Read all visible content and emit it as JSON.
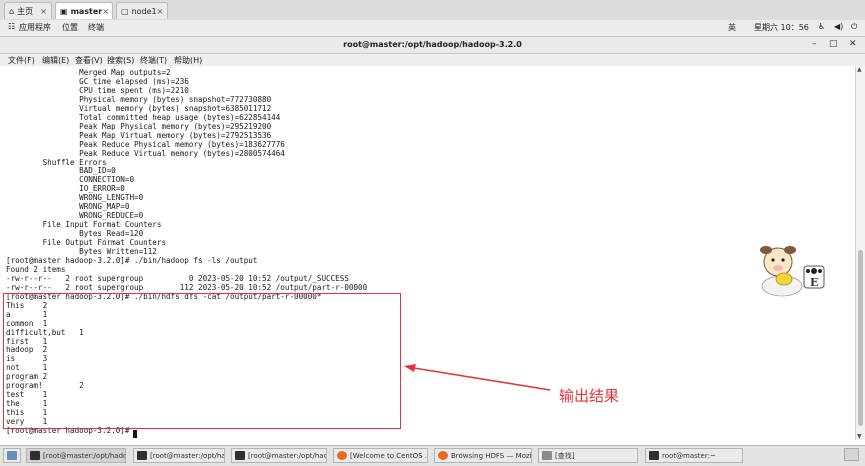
{
  "tabs": [
    {
      "label": "主页",
      "icon": "home-icon"
    },
    {
      "label": "master",
      "icon": "computer-icon"
    },
    {
      "label": "node1",
      "icon": "page-icon"
    }
  ],
  "topbar": {
    "menu_apps": "应用程序",
    "menu_places": "位置",
    "menu_terminal": "终端",
    "lang": "英",
    "clock": "星期六 10：56",
    "icons": [
      "accessibility-icon",
      "volume-icon",
      "power-icon"
    ]
  },
  "window": {
    "title": "root@master:/opt/hadoop/hadoop-3.2.0",
    "buttons": [
      "minimize-icon",
      "maximize-icon",
      "close-icon"
    ]
  },
  "menubar": [
    "文件(F)",
    "编辑(E)",
    "查看(V)",
    "搜索(S)",
    "终端(T)",
    "帮助(H)"
  ],
  "terminal_lines": [
    "                Merged Map outputs=2",
    "                GC time elapsed (ms)=236",
    "                CPU time spent (ms)=2210",
    "                Physical memory (bytes) snapshot=772730880",
    "                Virtual memory (bytes) snapshot=6385011712",
    "                Total committed heap usage (bytes)=622854144",
    "                Peak Map Physical memory (bytes)=295219200",
    "                Peak Map Virtual memory (bytes)=2792513536",
    "                Peak Reduce Physical memory (bytes)=183627776",
    "                Peak Reduce Virtual memory (bytes)=2800574464",
    "        Shuffle Errors",
    "                BAD_ID=0",
    "                CONNECTION=0",
    "                IO_ERROR=0",
    "                WRONG_LENGTH=0",
    "                WRONG_MAP=0",
    "                WRONG_REDUCE=0",
    "        File Input Format Counters",
    "                Bytes Read=120",
    "        File Output Format Counters",
    "                Bytes Written=112",
    "[root@master hadoop-3.2.0]# ./bin/hadoop fs -ls /output",
    "Found 2 items",
    "-rw-r--r--   2 root supergroup          0 2023-05-20 10:52 /output/_SUCCESS",
    "-rw-r--r--   2 root supergroup        112 2023-05-20 10:52 /output/part-r-00000",
    "[root@master hadoop-3.2.0]# ./bin/hdfs dfs -cat /output/part-r-00000*",
    "This    2",
    "a       1",
    "common  1",
    "difficult,but   1",
    "first   1",
    "hadoop  2",
    "is      3",
    "not     1",
    "program 2",
    "program!        2",
    "test    1",
    "the     1",
    "this    1",
    "very    1",
    "[root@master hadoop-3.2.0]# "
  ],
  "annotation": "输出结果",
  "taskbar": [
    {
      "label": "[root@master:/opt/hado...",
      "icon": "terminal-icon"
    },
    {
      "label": "[root@master:/opt/hado...",
      "icon": "terminal-icon"
    },
    {
      "label": "[root@master:/opt/hado...",
      "icon": "terminal-icon"
    },
    {
      "label": "[Welcome to CentOS ...",
      "icon": "firefox-icon"
    },
    {
      "label": "Browsing HDFS — Mozil...",
      "icon": "firefox-icon"
    },
    {
      "label": "[查找]",
      "icon": "search-icon"
    },
    {
      "label": "root@master:~",
      "icon": "terminal-icon"
    }
  ],
  "colors": {
    "annotation_red": "#e0363b"
  }
}
